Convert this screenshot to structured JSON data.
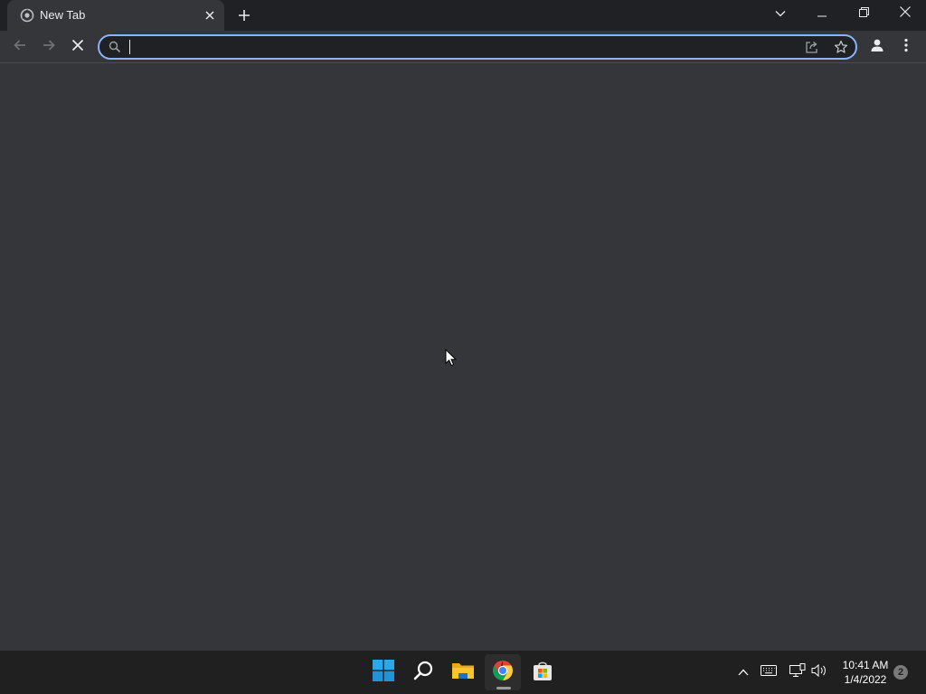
{
  "browser": {
    "tab": {
      "title": "New Tab",
      "favicon": "chrome-new-tab-icon"
    },
    "window_controls": [
      "tab-search-icon",
      "minimize-icon",
      "restore-icon",
      "close-icon"
    ],
    "toolbar": {
      "back_icon": "arrow-left-icon",
      "forward_icon": "arrow-right-icon",
      "stop_icon": "close-x-icon",
      "profile_icon": "person-icon",
      "menu_icon": "kebab-menu-icon"
    },
    "omnibox": {
      "value": "",
      "placeholder": "",
      "search_icon": "search-icon",
      "share_icon": "share-icon",
      "bookmark_icon": "star-icon"
    },
    "accent_color": "#8ab4f8"
  },
  "taskbar": {
    "apps": [
      "windows-start-icon",
      "search-icon",
      "file-explorer-icon",
      "chrome-icon",
      "microsoft-store-icon"
    ],
    "active_app": "chrome-icon",
    "tray": [
      "chevron-up-icon",
      "keyboard-icon",
      "network-icon",
      "volume-icon"
    ],
    "time": "10:41 AM",
    "date": "1/4/2022",
    "notifications": "2"
  }
}
